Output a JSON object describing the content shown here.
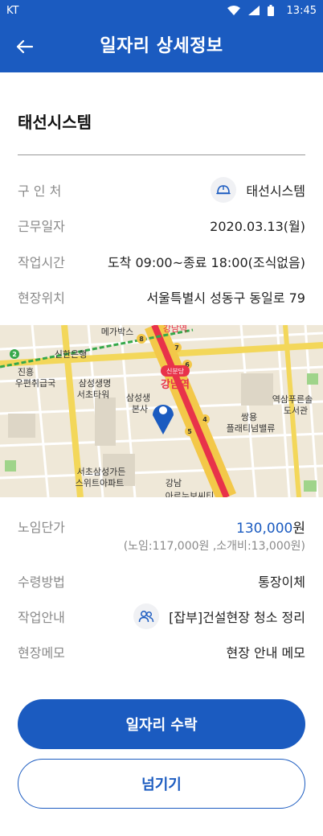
{
  "status_bar": {
    "carrier": "KT",
    "time": "13:45"
  },
  "header": {
    "title": "일자리 상세정보"
  },
  "company_name": "태선시스템",
  "details": {
    "employer": {
      "label": "구 인 처",
      "value": "태선시스템",
      "icon": "helmet-icon"
    },
    "work_date": {
      "label": "근무일자",
      "value": "2020.03.13(월)"
    },
    "work_time": {
      "label": "작업시간",
      "value": "도착 09:00~종료 18:00(조식없음)"
    },
    "site_location": {
      "label": "현장위치",
      "value": "서울특별시 성동구 동일로 79"
    }
  },
  "map": {
    "labels": {
      "megabox": "메가박스",
      "gangnam_top": "강남역",
      "shinhan": "신한은행",
      "jinheung": "진흥",
      "post_office": "우편취급국",
      "samsung_seocho": "삼성생명",
      "seocho_tower": "서초타워",
      "samsung_hq": "삼성생",
      "hq_suffix": "본사",
      "sinbundang": "신분당",
      "gangnam_station": "강남역",
      "yeoksam_library": "역삼푸른솔",
      "library_suffix": "도서관",
      "ssangyong": "쌍용",
      "platinum": "플래티넘밸류",
      "samsung_garden": "서초삼성가든",
      "suite_apt": "스위트아파트",
      "gangnam_bottom": "강남",
      "gangnam_bottom2": "아르누보씨티"
    },
    "station_numbers": [
      "2",
      "8",
      "7",
      "6",
      "4",
      "5"
    ]
  },
  "wage": {
    "label": "노임단가",
    "amount": "130,000",
    "unit": "원",
    "breakdown": "(노임:117,000원 ,소개비:13,000원)"
  },
  "payment_method": {
    "label": "수령방법",
    "value": "통장이체"
  },
  "work_guide": {
    "label": "작업안내",
    "value": "[잡부]건설현장 청소 정리",
    "icon": "people-icon"
  },
  "site_memo": {
    "label": "현장메모",
    "value": "현장 안내 메모"
  },
  "buttons": {
    "accept": "일자리 수락",
    "skip": "넘기기"
  },
  "colors": {
    "primary": "#1b5bc0",
    "label_gray": "#8a8a8a"
  }
}
